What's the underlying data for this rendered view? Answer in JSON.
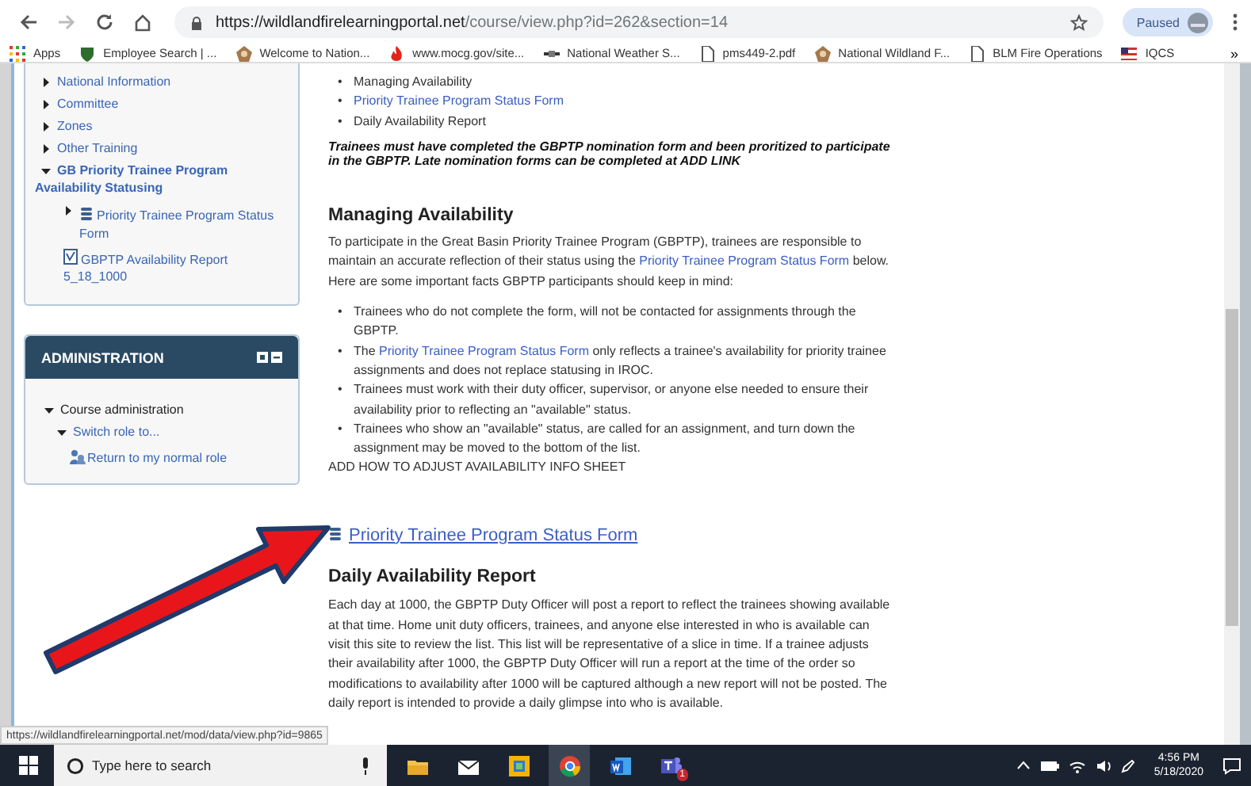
{
  "browser": {
    "forward_enabled": false,
    "url_host": "https://wildlandfirelearningportal.net",
    "url_path": "/course/view.php?id=262&section=14",
    "profile_label": "Paused",
    "bookmarks": [
      {
        "label": "Apps",
        "kind": "apps"
      },
      {
        "label": "Employee Search | ...",
        "kind": "shield"
      },
      {
        "label": "Welcome to Nation...",
        "kind": "emblem"
      },
      {
        "label": "www.mocg.gov/site...",
        "kind": "flame"
      },
      {
        "label": "National Weather S...",
        "kind": "bar"
      },
      {
        "label": "pms449-2.pdf",
        "kind": "page"
      },
      {
        "label": "National Wildland F...",
        "kind": "emblem"
      },
      {
        "label": "BLM Fire Operations",
        "kind": "page"
      },
      {
        "label": "IQCS",
        "kind": "flag"
      }
    ],
    "more": "»"
  },
  "sidebar": {
    "nav_items": [
      {
        "label": "National Information",
        "kind": "section",
        "expanded": false
      },
      {
        "label": "Committee",
        "kind": "section",
        "expanded": false
      },
      {
        "label": "Zones",
        "kind": "section",
        "expanded": false
      },
      {
        "label": "Other Training",
        "kind": "section",
        "expanded": false
      },
      {
        "label": "GB Priority Trainee Program Availability Statusing",
        "kind": "section",
        "expanded": true,
        "children": [
          {
            "label": "Priority Trainee Program Status Form",
            "kind": "database",
            "expanded": false
          },
          {
            "label": "GBPTP Availability Report 5_18_1000",
            "kind": "report"
          }
        ]
      }
    ],
    "admin": {
      "title": "ADMINISTRATION",
      "items": [
        {
          "label": "Course administration",
          "kind": "node",
          "expanded": true,
          "children": [
            {
              "label": "Switch role to...",
              "kind": "node",
              "expanded": true,
              "children": [
                {
                  "label": "Return to my normal role",
                  "kind": "role"
                }
              ]
            }
          ]
        }
      ]
    }
  },
  "main": {
    "toc": [
      {
        "bullet": "•",
        "text": "Managing Availability",
        "link": false
      },
      {
        "bullet": "•",
        "text": "Priority Trainee Program Status Form",
        "link": true
      },
      {
        "bullet": "•",
        "text": "Daily Availability Report",
        "link": false
      }
    ],
    "note": "Trainees must have completed the GBPTP nomination form and been proritized to participate in the GBPTP. Late nomination forms can be completed at ADD LINK",
    "heading_1": "Managing Availability",
    "paragraph_1": [
      {
        "text": "To participate in the Great Basin Priority Trainee Program (GBPTP), trainees are responsible to maintain an accurate reflection of their status using the ",
        "link": false
      },
      {
        "text": "Priority Trainee Program Status Form",
        "link": true
      },
      {
        "text": " below. Here are some important facts GBPTP participants should keep in mind:",
        "link": false
      }
    ],
    "facts": [
      {
        "bullet": "•",
        "segments": [
          {
            "text": "Trainees who do not complete the form, will not be contacted for assignments through the GBPTP.",
            "link": false
          }
        ]
      },
      {
        "bullet": "•",
        "segments": [
          {
            "text": "The ",
            "link": false
          },
          {
            "text": "Priority Trainee Program Status Form",
            "link": true
          },
          {
            "text": " only reflects a trainee's availability for priority trainee assignments and does not replace statusing in IROC.",
            "link": false
          }
        ]
      },
      {
        "bullet": "•",
        "segments": [
          {
            "text": "Trainees must work with their duty officer, supervisor, or anyone else needed to ensure their availability prior to reflecting an \"available\" status.",
            "link": false
          }
        ]
      },
      {
        "bullet": "•",
        "segments": [
          {
            "text": "Trainees who show an \"available\" status, are called for an assignment, and turn down the assignment may be moved to the bottom of the list.",
            "link": false
          }
        ]
      }
    ],
    "todo": "ADD HOW TO ADJUST AVAILABILITY INFO SHEET",
    "form_link": "Priority Trainee Program Status Form",
    "heading_2": "Daily Availability Report",
    "paragraph_2": "Each day at 1000, the GBPTP Duty Officer will post a report to reflect the trainees showing available at that time. Home unit duty officers, trainees, and anyone else interested in who is available can visit this site to review the list. This list will be representative of a slice in time. If a trainee adjusts their availability after 1000, the GBPTP Duty Officer will run a report at the time of the order so modifications to availability after 1000 will be captured although a new report will not be posted. The daily report is intended to provide a daily glimpse into who is available."
  },
  "status_url": "https://wildlandfirelearningportal.net/mod/data/view.php?id=9865",
  "taskbar": {
    "search_placeholder": "Type here to search",
    "apps": [
      {
        "kind": "folder"
      },
      {
        "kind": "mail"
      },
      {
        "kind": "photos"
      },
      {
        "kind": "chrome"
      },
      {
        "kind": "word"
      },
      {
        "kind": "teams",
        "badge": "1"
      }
    ],
    "time": "4:56 PM",
    "date": "5/18/2020"
  }
}
